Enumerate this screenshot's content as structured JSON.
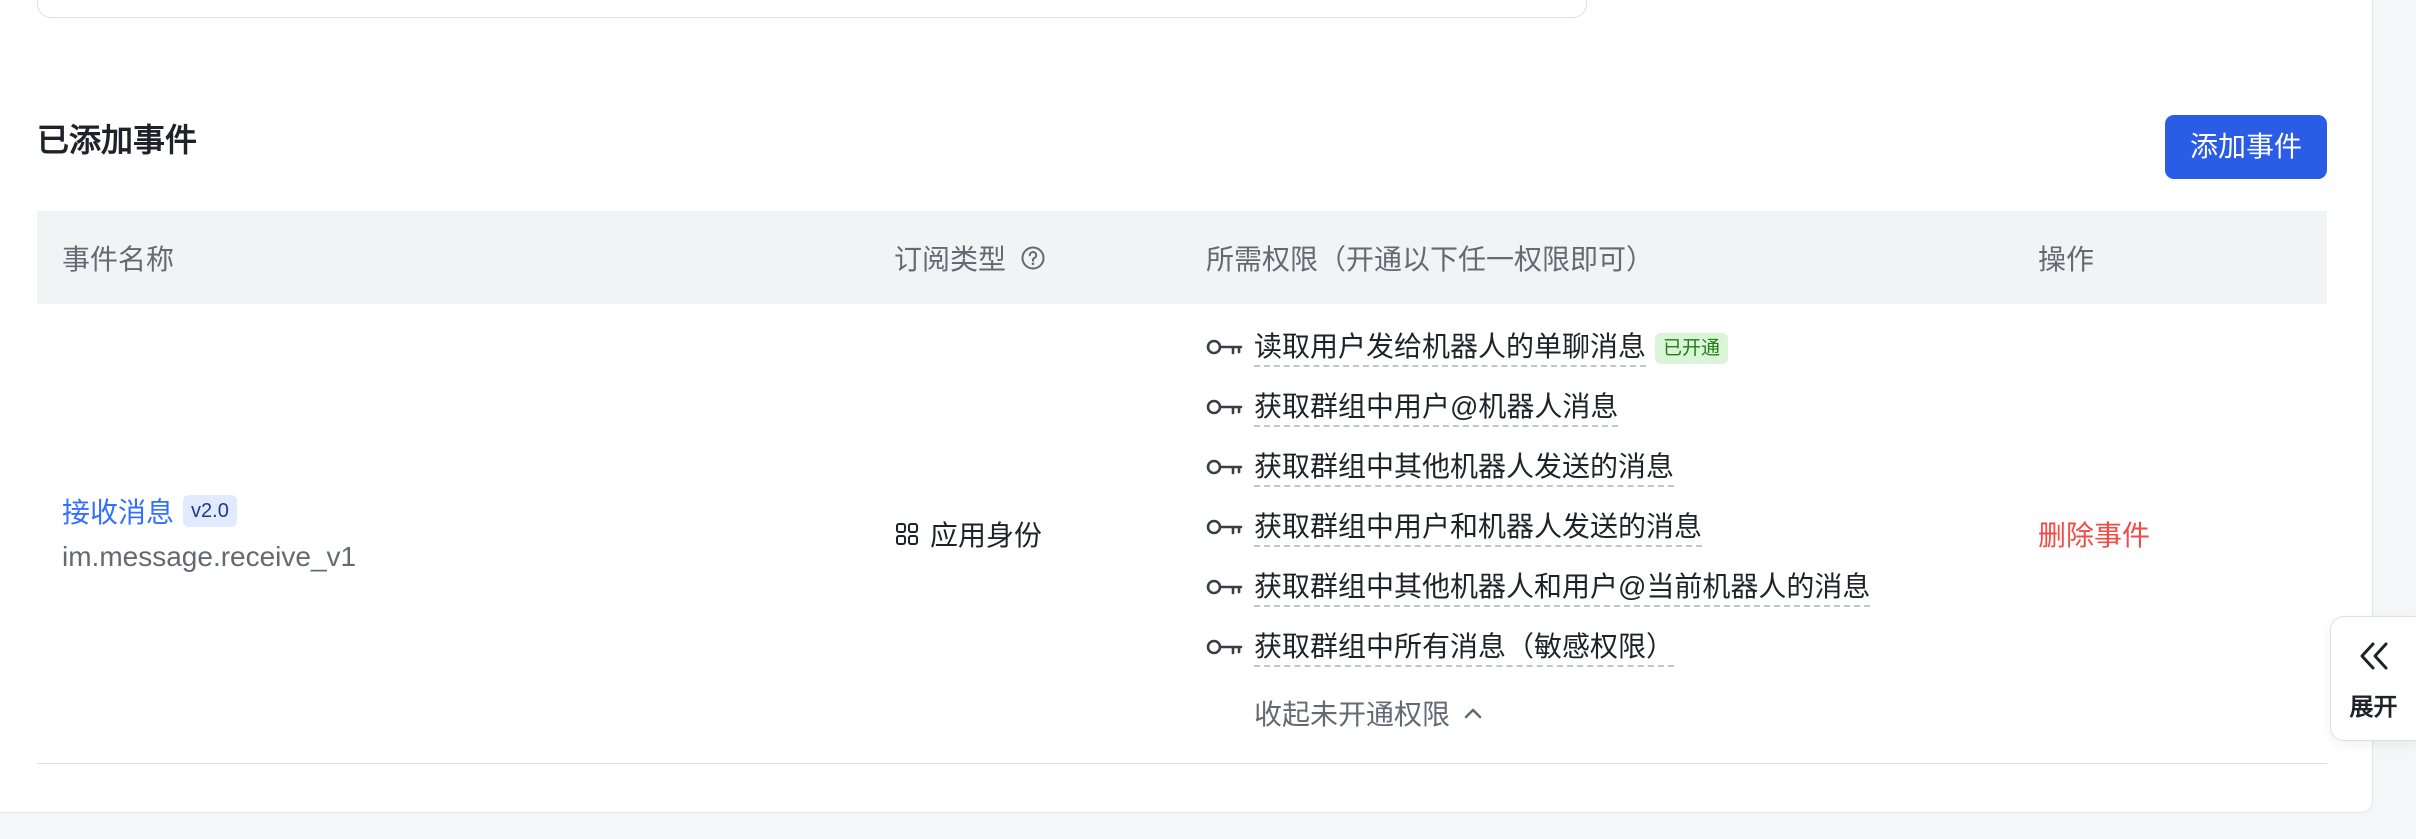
{
  "section": {
    "title": "已添加事件",
    "add_button_label": "添加事件"
  },
  "table": {
    "headers": {
      "name": "事件名称",
      "type": "订阅类型",
      "permissions": "所需权限（开通以下任一权限即可）",
      "actions": "操作"
    },
    "rows": [
      {
        "event_name": "接收消息",
        "version": "v2.0",
        "event_key": "im.message.receive_v1",
        "subscription_type": "应用身份",
        "permissions": [
          {
            "label": "读取用户发给机器人的单聊消息",
            "status": "已开通"
          },
          {
            "label": "获取群组中用户@机器人消息"
          },
          {
            "label": "获取群组中其他机器人发送的消息"
          },
          {
            "label": "获取群组中用户和机器人发送的消息"
          },
          {
            "label": "获取群组中其他机器人和用户@当前机器人的消息"
          },
          {
            "label": "获取群组中所有消息（敏感权限）"
          }
        ],
        "collapse_label": "收起未开通权限",
        "delete_label": "删除事件"
      }
    ]
  },
  "side_panel": {
    "expand_label": "展开"
  },
  "icons": {
    "header_help": "help-circle-icon",
    "subscription_type": "grid-icon",
    "permission": "key-icon",
    "collapse": "chevron-up-icon",
    "expand": "double-chevron-left-icon"
  },
  "colors": {
    "primary": "#2b5ce6",
    "link": "#3370ff",
    "danger": "#f54a45",
    "header_bg": "#f2f3f5",
    "enabled_badge_bg": "#d9f5d6",
    "enabled_badge_text": "#237b19",
    "version_badge_bg": "#e1eaff"
  }
}
